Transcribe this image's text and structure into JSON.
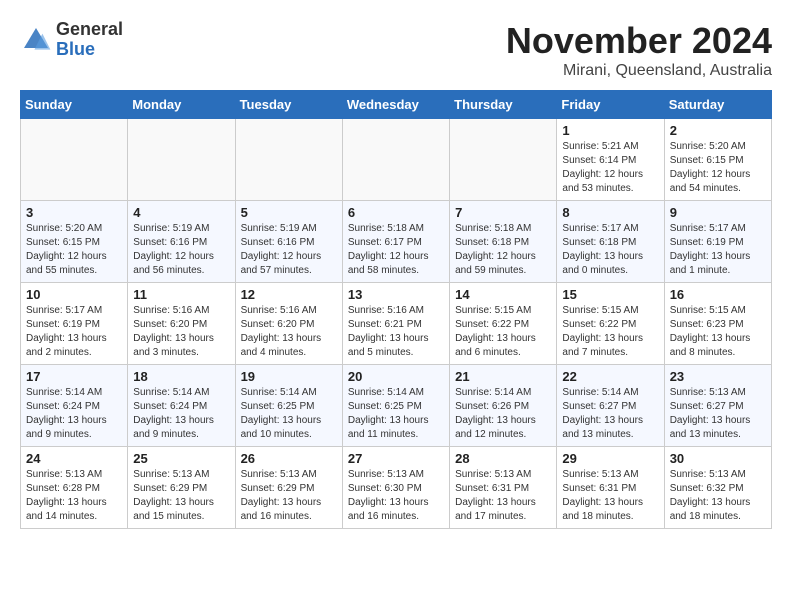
{
  "logo": {
    "general": "General",
    "blue": "Blue"
  },
  "title": "November 2024",
  "location": "Mirani, Queensland, Australia",
  "weekdays": [
    "Sunday",
    "Monday",
    "Tuesday",
    "Wednesday",
    "Thursday",
    "Friday",
    "Saturday"
  ],
  "weeks": [
    [
      {
        "day": "",
        "info": ""
      },
      {
        "day": "",
        "info": ""
      },
      {
        "day": "",
        "info": ""
      },
      {
        "day": "",
        "info": ""
      },
      {
        "day": "",
        "info": ""
      },
      {
        "day": "1",
        "info": "Sunrise: 5:21 AM\nSunset: 6:14 PM\nDaylight: 12 hours\nand 53 minutes."
      },
      {
        "day": "2",
        "info": "Sunrise: 5:20 AM\nSunset: 6:15 PM\nDaylight: 12 hours\nand 54 minutes."
      }
    ],
    [
      {
        "day": "3",
        "info": "Sunrise: 5:20 AM\nSunset: 6:15 PM\nDaylight: 12 hours\nand 55 minutes."
      },
      {
        "day": "4",
        "info": "Sunrise: 5:19 AM\nSunset: 6:16 PM\nDaylight: 12 hours\nand 56 minutes."
      },
      {
        "day": "5",
        "info": "Sunrise: 5:19 AM\nSunset: 6:16 PM\nDaylight: 12 hours\nand 57 minutes."
      },
      {
        "day": "6",
        "info": "Sunrise: 5:18 AM\nSunset: 6:17 PM\nDaylight: 12 hours\nand 58 minutes."
      },
      {
        "day": "7",
        "info": "Sunrise: 5:18 AM\nSunset: 6:18 PM\nDaylight: 12 hours\nand 59 minutes."
      },
      {
        "day": "8",
        "info": "Sunrise: 5:17 AM\nSunset: 6:18 PM\nDaylight: 13 hours\nand 0 minutes."
      },
      {
        "day": "9",
        "info": "Sunrise: 5:17 AM\nSunset: 6:19 PM\nDaylight: 13 hours\nand 1 minute."
      }
    ],
    [
      {
        "day": "10",
        "info": "Sunrise: 5:17 AM\nSunset: 6:19 PM\nDaylight: 13 hours\nand 2 minutes."
      },
      {
        "day": "11",
        "info": "Sunrise: 5:16 AM\nSunset: 6:20 PM\nDaylight: 13 hours\nand 3 minutes."
      },
      {
        "day": "12",
        "info": "Sunrise: 5:16 AM\nSunset: 6:20 PM\nDaylight: 13 hours\nand 4 minutes."
      },
      {
        "day": "13",
        "info": "Sunrise: 5:16 AM\nSunset: 6:21 PM\nDaylight: 13 hours\nand 5 minutes."
      },
      {
        "day": "14",
        "info": "Sunrise: 5:15 AM\nSunset: 6:22 PM\nDaylight: 13 hours\nand 6 minutes."
      },
      {
        "day": "15",
        "info": "Sunrise: 5:15 AM\nSunset: 6:22 PM\nDaylight: 13 hours\nand 7 minutes."
      },
      {
        "day": "16",
        "info": "Sunrise: 5:15 AM\nSunset: 6:23 PM\nDaylight: 13 hours\nand 8 minutes."
      }
    ],
    [
      {
        "day": "17",
        "info": "Sunrise: 5:14 AM\nSunset: 6:24 PM\nDaylight: 13 hours\nand 9 minutes."
      },
      {
        "day": "18",
        "info": "Sunrise: 5:14 AM\nSunset: 6:24 PM\nDaylight: 13 hours\nand 9 minutes."
      },
      {
        "day": "19",
        "info": "Sunrise: 5:14 AM\nSunset: 6:25 PM\nDaylight: 13 hours\nand 10 minutes."
      },
      {
        "day": "20",
        "info": "Sunrise: 5:14 AM\nSunset: 6:25 PM\nDaylight: 13 hours\nand 11 minutes."
      },
      {
        "day": "21",
        "info": "Sunrise: 5:14 AM\nSunset: 6:26 PM\nDaylight: 13 hours\nand 12 minutes."
      },
      {
        "day": "22",
        "info": "Sunrise: 5:14 AM\nSunset: 6:27 PM\nDaylight: 13 hours\nand 13 minutes."
      },
      {
        "day": "23",
        "info": "Sunrise: 5:13 AM\nSunset: 6:27 PM\nDaylight: 13 hours\nand 13 minutes."
      }
    ],
    [
      {
        "day": "24",
        "info": "Sunrise: 5:13 AM\nSunset: 6:28 PM\nDaylight: 13 hours\nand 14 minutes."
      },
      {
        "day": "25",
        "info": "Sunrise: 5:13 AM\nSunset: 6:29 PM\nDaylight: 13 hours\nand 15 minutes."
      },
      {
        "day": "26",
        "info": "Sunrise: 5:13 AM\nSunset: 6:29 PM\nDaylight: 13 hours\nand 16 minutes."
      },
      {
        "day": "27",
        "info": "Sunrise: 5:13 AM\nSunset: 6:30 PM\nDaylight: 13 hours\nand 16 minutes."
      },
      {
        "day": "28",
        "info": "Sunrise: 5:13 AM\nSunset: 6:31 PM\nDaylight: 13 hours\nand 17 minutes."
      },
      {
        "day": "29",
        "info": "Sunrise: 5:13 AM\nSunset: 6:31 PM\nDaylight: 13 hours\nand 18 minutes."
      },
      {
        "day": "30",
        "info": "Sunrise: 5:13 AM\nSunset: 6:32 PM\nDaylight: 13 hours\nand 18 minutes."
      }
    ]
  ]
}
